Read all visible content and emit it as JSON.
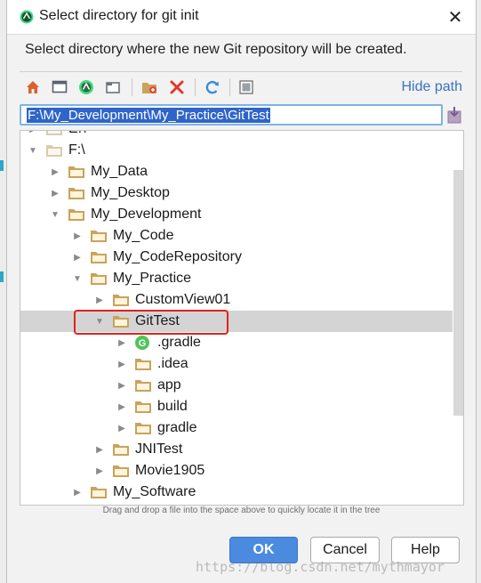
{
  "dialog": {
    "title": "Select directory for git init",
    "description": "Select directory where the new Git repository will be created.",
    "hide_path_label": "Hide path",
    "path_value": "F:\\My_Development\\My_Practice\\GitTest",
    "hint": "Drag and drop a file into the space above to quickly locate it in the tree",
    "buttons": {
      "ok": "OK",
      "cancel": "Cancel",
      "help": "Help"
    },
    "close_glyph": "✕"
  },
  "toolbar": {
    "icons": [
      "home-icon",
      "desktop-icon",
      "project-icon",
      "module-icon",
      "new-folder-icon",
      "delete-icon",
      "refresh-icon",
      "show-hidden-icon"
    ]
  },
  "tree": {
    "rows": [
      {
        "label": "E:\\",
        "depth": 0,
        "expanded": false,
        "icon": "drive"
      },
      {
        "label": "F:\\",
        "depth": 0,
        "expanded": true,
        "icon": "drive"
      },
      {
        "label": "My_Data",
        "depth": 1,
        "expanded": false,
        "icon": "folder"
      },
      {
        "label": "My_Desktop",
        "depth": 1,
        "expanded": false,
        "icon": "folder"
      },
      {
        "label": "My_Development",
        "depth": 1,
        "expanded": true,
        "icon": "folder"
      },
      {
        "label": "My_Code",
        "depth": 2,
        "expanded": false,
        "icon": "folder"
      },
      {
        "label": "My_CodeRepository",
        "depth": 2,
        "expanded": false,
        "icon": "folder"
      },
      {
        "label": "My_Practice",
        "depth": 2,
        "expanded": true,
        "icon": "folder"
      },
      {
        "label": "CustomView01",
        "depth": 3,
        "expanded": false,
        "icon": "folder"
      },
      {
        "label": "GitTest",
        "depth": 3,
        "expanded": true,
        "icon": "folder",
        "selected": true
      },
      {
        "label": ".gradle",
        "depth": 4,
        "expanded": false,
        "icon": "gradle"
      },
      {
        "label": ".idea",
        "depth": 4,
        "expanded": false,
        "icon": "folder"
      },
      {
        "label": "app",
        "depth": 4,
        "expanded": false,
        "icon": "folder"
      },
      {
        "label": "build",
        "depth": 4,
        "expanded": false,
        "icon": "folder"
      },
      {
        "label": "gradle",
        "depth": 4,
        "expanded": false,
        "icon": "folder"
      },
      {
        "label": "JNITest",
        "depth": 3,
        "expanded": false,
        "icon": "folder"
      },
      {
        "label": "Movie1905",
        "depth": 3,
        "expanded": false,
        "icon": "folder"
      },
      {
        "label": "My_Software",
        "depth": 2,
        "expanded": false,
        "icon": "folder"
      }
    ]
  },
  "watermark": "https://blog.csdn.net/mythmayor",
  "colors": {
    "accent": "#4a8be0",
    "selection": "#2f65ca",
    "highlight_box": "#e0231a",
    "folder": "#c9a35c",
    "link": "#3b73c2"
  }
}
